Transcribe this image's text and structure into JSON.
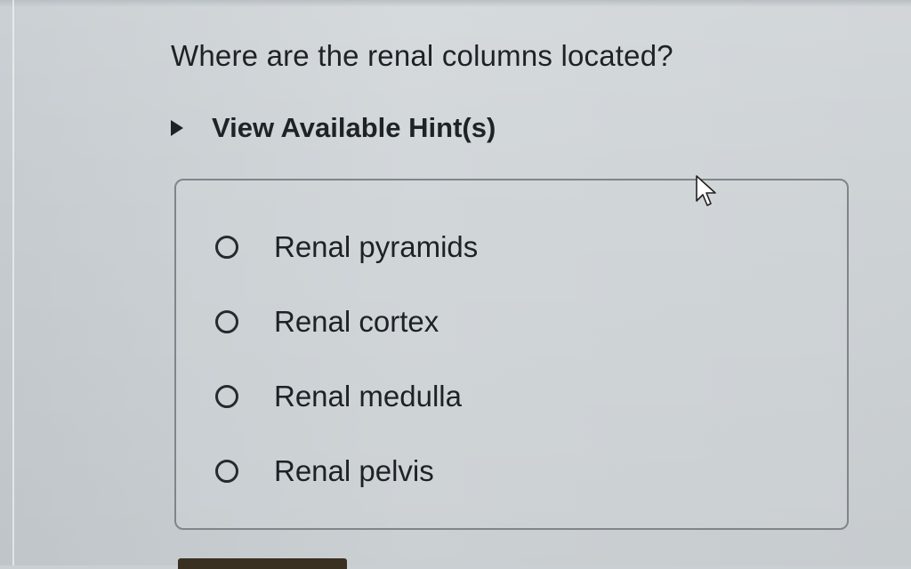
{
  "question": {
    "text": "Where are the renal columns located?"
  },
  "hint": {
    "label": "View Available Hint(s)"
  },
  "options": [
    {
      "label": "Renal pyramids"
    },
    {
      "label": "Renal cortex"
    },
    {
      "label": "Renal medulla"
    },
    {
      "label": "Renal pelvis"
    }
  ],
  "icons": {
    "cursor": "arrow-pointer-icon",
    "hint_toggle": "triangle-right-icon",
    "radio": "radio-unchecked-icon"
  },
  "colors": {
    "text": "#1e2226",
    "background": "#cdd2d5",
    "box_border": "#7f8589"
  }
}
